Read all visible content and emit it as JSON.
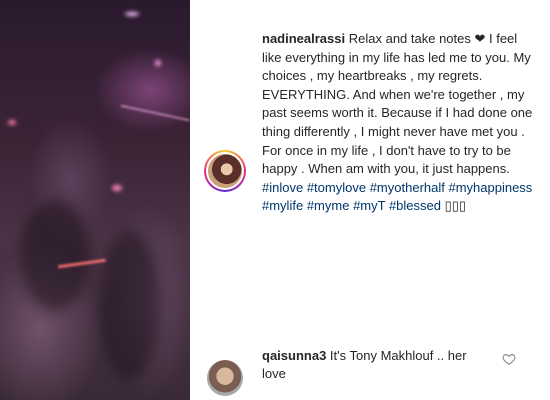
{
  "post": {
    "author": "nadinealrassi",
    "caption": "Relax and take notes ❤ I feel like everything in my life has led me to you. My choices , my heartbreaks , my regrets. EVERYTHING. And when we're together , my past seems worth it. Because if I had done one thing differently , I might never have met you . For once in my life , I don't have to try to be happy . When am with you, it just happens.",
    "hashtags": [
      "#inlove",
      "#tomylove",
      "#myotherhalf",
      "#myhappiness",
      "#mylife",
      "#myme",
      "#myT",
      "#blessed"
    ],
    "trailing_emoji": "▯▯▯"
  },
  "comment": {
    "author": "qaisunna3",
    "text": "It's Tony Makhlouf .. her love"
  },
  "icons": {
    "comment_like": "heart-outline-icon",
    "avatar_ring": "story-ring"
  },
  "colors": {
    "text": "#262626",
    "hashtag": "#00376b",
    "heart_outline": "#8e8e8e"
  }
}
